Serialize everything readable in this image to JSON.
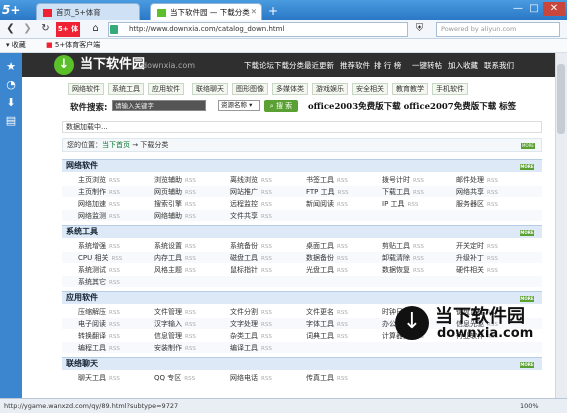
{
  "browser": {
    "logo": "5+",
    "tabs": [
      {
        "label": "首页_5+体育",
        "active": false
      },
      {
        "label": "当下软件园 — 下载分类",
        "active": true
      }
    ],
    "new_tab": "+",
    "window_buttons": {
      "minimize": "—",
      "maximize": "□",
      "close": "✕"
    },
    "address": "http://www.downxia.com/catalog_down.html",
    "search_placeholder": "Powered by aliyun.com",
    "favorites_label": "收藏",
    "favorites_items": [
      "5+体育客户端"
    ],
    "badge_5plus": "5+ 体育",
    "status_url": "http://ygame.wanxzd.com/qy/89.html?subtype=9727",
    "zoom": "100%"
  },
  "site": {
    "title": "当下软件园",
    "domain": "downxia.com",
    "top_nav": [
      "下载论坛",
      "下载分类",
      "最近更新",
      "推荐软件",
      "排 行 榜",
      "一键转帖",
      "加入收藏",
      "联系我们"
    ],
    "categories": [
      "网络软件",
      "系统工具",
      "应用软件",
      "联络聊天",
      "图形图像",
      "多媒体类",
      "游戏娱乐",
      "安全相关",
      "教育教学",
      "手机软件"
    ],
    "search_label": "软件搜索:",
    "search_placeholder": "请输入关键字",
    "sort_option": "资源名称",
    "search_button": "搜 索",
    "promo": "office2003免费版下载  office2007免费版下载  标签",
    "loading": "数据加载中...",
    "breadcrumb_prefix": "您的位置：",
    "breadcrumb_home": "当下首页",
    "breadcrumb_arrow": "→",
    "breadcrumb_current": "下载分类",
    "more_badge": "MORE",
    "rss": "RSS",
    "sections": [
      {
        "title": "网络软件",
        "rows": [
          [
            "主页浏览",
            "浏览辅助",
            "离线浏览",
            "书签工具",
            "拨号计时",
            "邮件处理"
          ],
          [
            "主页制作",
            "网页辅助",
            "网站推广",
            "FTP 工具",
            "下载工具",
            "网络共享"
          ],
          [
            "网络加速",
            "搜索引擎",
            "远程监控",
            "新闻阅读",
            "IP 工具",
            "服务器区"
          ],
          [
            "网络监测",
            "网络辅助",
            "文件共享"
          ]
        ]
      },
      {
        "title": "系统工具",
        "rows": [
          [
            "系统增强",
            "系统设置",
            "系统备份",
            "桌面工具",
            "剪贴工具",
            "开关定时"
          ],
          [
            "CPU 相关",
            "内存工具",
            "磁盘工具",
            "数据备份",
            "卸载清除",
            "升级补丁"
          ],
          [
            "系统测试",
            "风格主题",
            "鼠标指针",
            "光盘工具",
            "数据恢复",
            "硬件相关"
          ],
          [
            "系统其它"
          ]
        ]
      },
      {
        "title": "应用软件",
        "rows": [
          [
            "压缩解压",
            "文件管理",
            "文件分割",
            "文件更名",
            "时钟日历",
            "键盘鼠标"
          ],
          [
            "电子阅读",
            "汉字输入",
            "文字处理",
            "字体工具",
            "办公软件",
            "信息光驱"
          ],
          [
            "转换翻译",
            "信息管理",
            "杂类工具",
            "词典工具",
            "计算器类",
            "行业软件"
          ],
          [
            "编程工具",
            "安装制作",
            "编译工具"
          ]
        ]
      },
      {
        "title": "联络聊天",
        "rows": [
          [
            "聊天工具",
            "QQ 专区",
            "网络电话",
            "传真工具"
          ]
        ]
      }
    ]
  },
  "watermark": {
    "symbol": "↓",
    "title": "当下软件园",
    "domain": "downxia.com"
  },
  "icons": [
    "back-icon",
    "forward-icon",
    "refresh-icon",
    "home-icon",
    "star-icon",
    "download-icon",
    "note-icon"
  ]
}
